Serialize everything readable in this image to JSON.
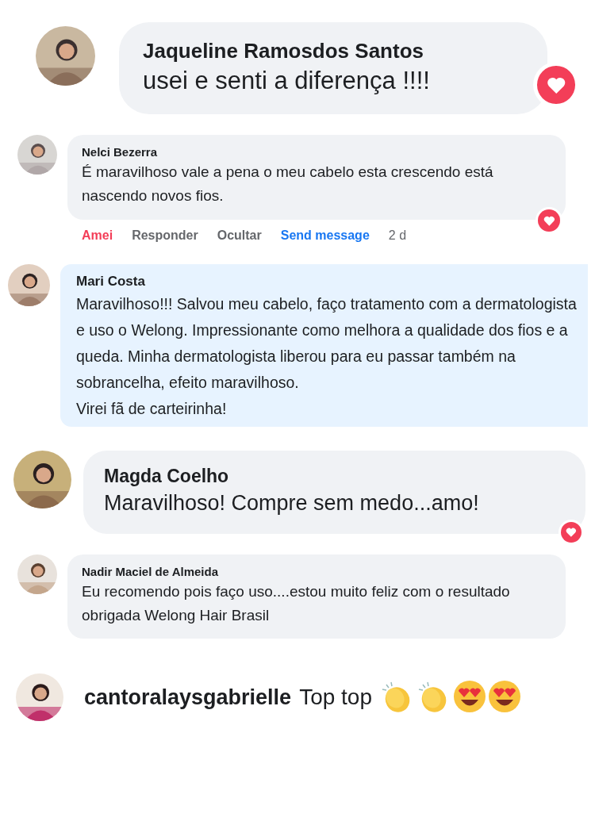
{
  "comments": [
    {
      "kind": "large",
      "name": "Jaqueline Ramosdos Santos",
      "text": "usei e senti a diferença !!!!",
      "reacted": true,
      "avatar": {
        "kind": "picture"
      }
    },
    {
      "kind": "compact",
      "name": "Nelci Bezerra",
      "text": "É maravilhoso vale a pena o meu cabelo esta crescendo está nascendo novos fios.",
      "reacted": true,
      "avatar": {
        "kind": "picture"
      },
      "actions": [
        {
          "label": "Amei",
          "kind": "reaction"
        },
        {
          "label": "Responder",
          "kind": "action"
        },
        {
          "label": "Ocultar",
          "kind": "action"
        },
        {
          "label": "Send message",
          "kind": "link"
        },
        {
          "label": "2 d",
          "kind": "time"
        }
      ]
    },
    {
      "kind": "highlight",
      "name": "Mari Costa",
      "text": "Maravilhoso!!! Salvou meu cabelo, faço tratamento com a dermatologista e uso o Welong. Impressionante como melhora a qualidade dos fios e a queda. Minha dermatologista liberou para eu passar também na sobrancelha, efeito maravilhoso.\nVirei fã de carteirinha!",
      "reacted": false,
      "avatar": {
        "kind": "picture"
      }
    },
    {
      "kind": "medium",
      "name": "Magda Coelho",
      "text": "Maravilhoso! Compre sem medo...amo!",
      "reacted": true,
      "avatar": {
        "kind": "picture"
      }
    },
    {
      "kind": "compact",
      "name": "Nadir Maciel de Almeida",
      "text": "Eu recomendo pois faço uso....estou muito feliz com o resultado obrigada Welong Hair Brasil",
      "reacted": false,
      "avatar": {
        "kind": "picture"
      }
    },
    {
      "kind": "inline",
      "name": "cantoralaysgabrielle",
      "text": "Top top",
      "reacted": false,
      "avatar": {
        "kind": "picture"
      }
    }
  ]
}
